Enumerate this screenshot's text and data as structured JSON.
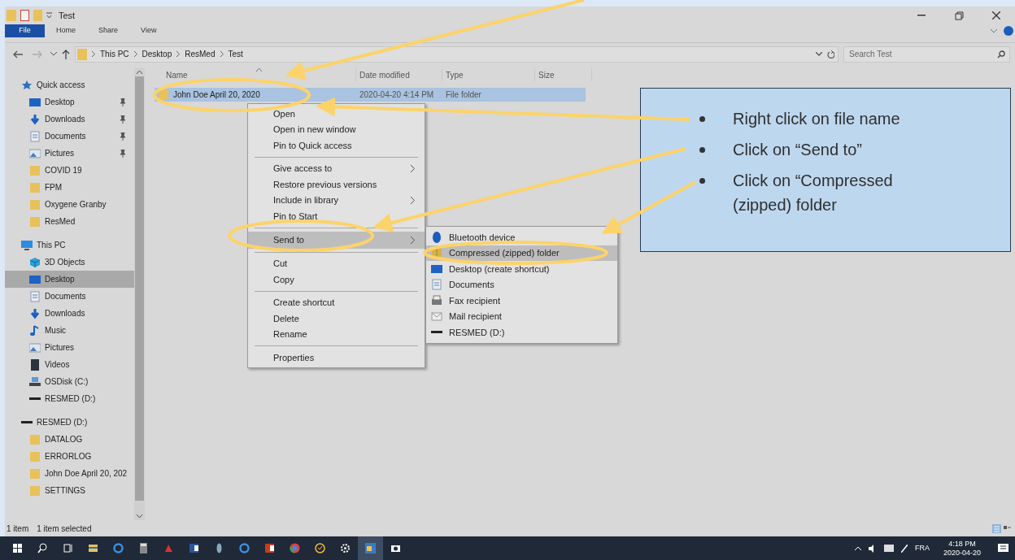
{
  "window": {
    "title": "Test"
  },
  "ribbon_tabs": [
    {
      "label": "File",
      "kind": "file"
    },
    {
      "label": "Home",
      "kind": "tab"
    },
    {
      "label": "Share",
      "kind": "tab"
    },
    {
      "label": "View",
      "kind": "tab"
    }
  ],
  "address": {
    "path": [
      "This PC",
      "Desktop",
      "ResMed",
      "Test"
    ]
  },
  "search": {
    "placeholder": "Search Test"
  },
  "nav": [
    {
      "label": "Quick access",
      "kind": "star",
      "selected": false,
      "children": [
        {
          "label": "Desktop",
          "kind": "desktop",
          "pinned": true,
          "selected": false
        },
        {
          "label": "Downloads",
          "kind": "download",
          "pinned": true,
          "selected": false
        },
        {
          "label": "Documents",
          "kind": "documents",
          "pinned": true,
          "selected": false
        },
        {
          "label": "Pictures",
          "kind": "pictures",
          "pinned": true,
          "selected": false
        },
        {
          "label": "COVID 19",
          "kind": "folder",
          "pinned": false,
          "selected": false
        },
        {
          "label": "FPM",
          "kind": "folder",
          "pinned": false,
          "selected": false
        },
        {
          "label": "Oxygene Granby",
          "kind": "folder",
          "pinned": false,
          "selected": false
        },
        {
          "label": "ResMed",
          "kind": "folder",
          "pinned": false,
          "selected": false
        }
      ]
    },
    {
      "label": "This PC",
      "kind": "pc",
      "selected": false,
      "children": [
        {
          "label": "3D Objects",
          "kind": "cube",
          "selected": false
        },
        {
          "label": "Desktop",
          "kind": "desktop",
          "selected": true
        },
        {
          "label": "Documents",
          "kind": "documents",
          "selected": false
        },
        {
          "label": "Downloads",
          "kind": "download",
          "selected": false
        },
        {
          "label": "Music",
          "kind": "music",
          "selected": false
        },
        {
          "label": "Pictures",
          "kind": "pictures",
          "selected": false
        },
        {
          "label": "Videos",
          "kind": "videos",
          "selected": false
        },
        {
          "label": "OSDisk (C:)",
          "kind": "disk",
          "selected": false
        },
        {
          "label": "RESMED (D:)",
          "kind": "drive",
          "selected": false
        }
      ]
    },
    {
      "label": "RESMED (D:)",
      "kind": "drive",
      "selected": false,
      "children": [
        {
          "label": "DATALOG",
          "kind": "folder",
          "selected": false
        },
        {
          "label": "ERRORLOG",
          "kind": "folder",
          "selected": false
        },
        {
          "label": "John Doe April 20, 202",
          "kind": "folder",
          "selected": false
        },
        {
          "label": "SETTINGS",
          "kind": "folder",
          "selected": false
        }
      ]
    }
  ],
  "columns": [
    "Name",
    "Date modified",
    "Type",
    "Size"
  ],
  "rows": [
    {
      "name": "John Doe April 20, 2020",
      "date_modified": "2020-04-20 4:14 PM",
      "type": "File folder",
      "selected": true
    }
  ],
  "context_menu": [
    {
      "kind": "item",
      "label": "Open",
      "has_submenu": false,
      "selected": false
    },
    {
      "kind": "item",
      "label": "Open in new window",
      "has_submenu": false,
      "selected": false
    },
    {
      "kind": "item",
      "label": "Pin to Quick access",
      "has_submenu": false,
      "selected": false
    },
    {
      "kind": "separator"
    },
    {
      "kind": "item",
      "label": "Give access to",
      "has_submenu": true,
      "selected": false
    },
    {
      "kind": "item",
      "label": "Restore previous versions",
      "has_submenu": false,
      "selected": false
    },
    {
      "kind": "item",
      "label": "Include in library",
      "has_submenu": true,
      "selected": false
    },
    {
      "kind": "item",
      "label": "Pin to Start",
      "has_submenu": false,
      "selected": false
    },
    {
      "kind": "separator"
    },
    {
      "kind": "item",
      "label": "Send to",
      "has_submenu": true,
      "selected": true
    },
    {
      "kind": "separator"
    },
    {
      "kind": "item",
      "label": "Cut",
      "has_submenu": false,
      "selected": false
    },
    {
      "kind": "item",
      "label": "Copy",
      "has_submenu": false,
      "selected": false
    },
    {
      "kind": "separator"
    },
    {
      "kind": "item",
      "label": "Create shortcut",
      "has_submenu": false,
      "selected": false
    },
    {
      "kind": "item",
      "label": "Delete",
      "has_submenu": false,
      "selected": false
    },
    {
      "kind": "item",
      "label": "Rename",
      "has_submenu": false,
      "selected": false
    },
    {
      "kind": "separator"
    },
    {
      "kind": "item",
      "label": "Properties",
      "has_submenu": false,
      "selected": false
    }
  ],
  "send_to_menu": [
    {
      "label": "Bluetooth device",
      "kind": "bluetooth",
      "selected": false
    },
    {
      "label": "Compressed (zipped) folder",
      "kind": "zip",
      "selected": true
    },
    {
      "label": "Desktop (create shortcut)",
      "kind": "desktop",
      "selected": false
    },
    {
      "label": "Documents",
      "kind": "documents",
      "selected": false
    },
    {
      "label": "Fax recipient",
      "kind": "fax",
      "selected": false
    },
    {
      "label": "Mail recipient",
      "kind": "mail",
      "selected": false
    },
    {
      "label": "RESMED (D:)",
      "kind": "drive",
      "selected": false
    }
  ],
  "status_bar": {
    "item_count": "1 item",
    "selection": "1 item selected"
  },
  "taskbar": {
    "language": "FRA",
    "time": "4:18 PM",
    "date": "2020-04-20"
  },
  "callout": {
    "steps": [
      "Right click on file name",
      "Click on “Send to”",
      "Click on “Compressed (zipped) folder"
    ]
  }
}
